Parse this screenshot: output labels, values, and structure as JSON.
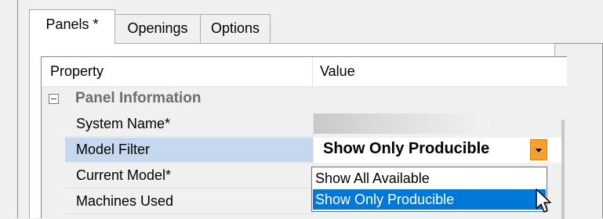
{
  "tabs": [
    {
      "label": "Panels *",
      "active": true
    },
    {
      "label": "Openings",
      "active": false
    },
    {
      "label": "Options",
      "active": false
    }
  ],
  "grid": {
    "headers": {
      "property": "Property",
      "value": "Value"
    },
    "section": {
      "label": "Panel Information",
      "expanded": true
    },
    "rows": [
      {
        "label": "System Name*",
        "value": ""
      },
      {
        "label": "Model Filter",
        "value": "Show Only Producible"
      },
      {
        "label": "Current Model*",
        "value": ""
      },
      {
        "label": "Machines Used",
        "value": ""
      }
    ]
  },
  "dropdown": {
    "options": [
      "Show All Available",
      "Show Only Producible"
    ],
    "highlighted_index": 1
  },
  "colors": {
    "selection": "#0078d7",
    "combo_button": "#f5a030",
    "row_selected": "#c6d8ee"
  }
}
